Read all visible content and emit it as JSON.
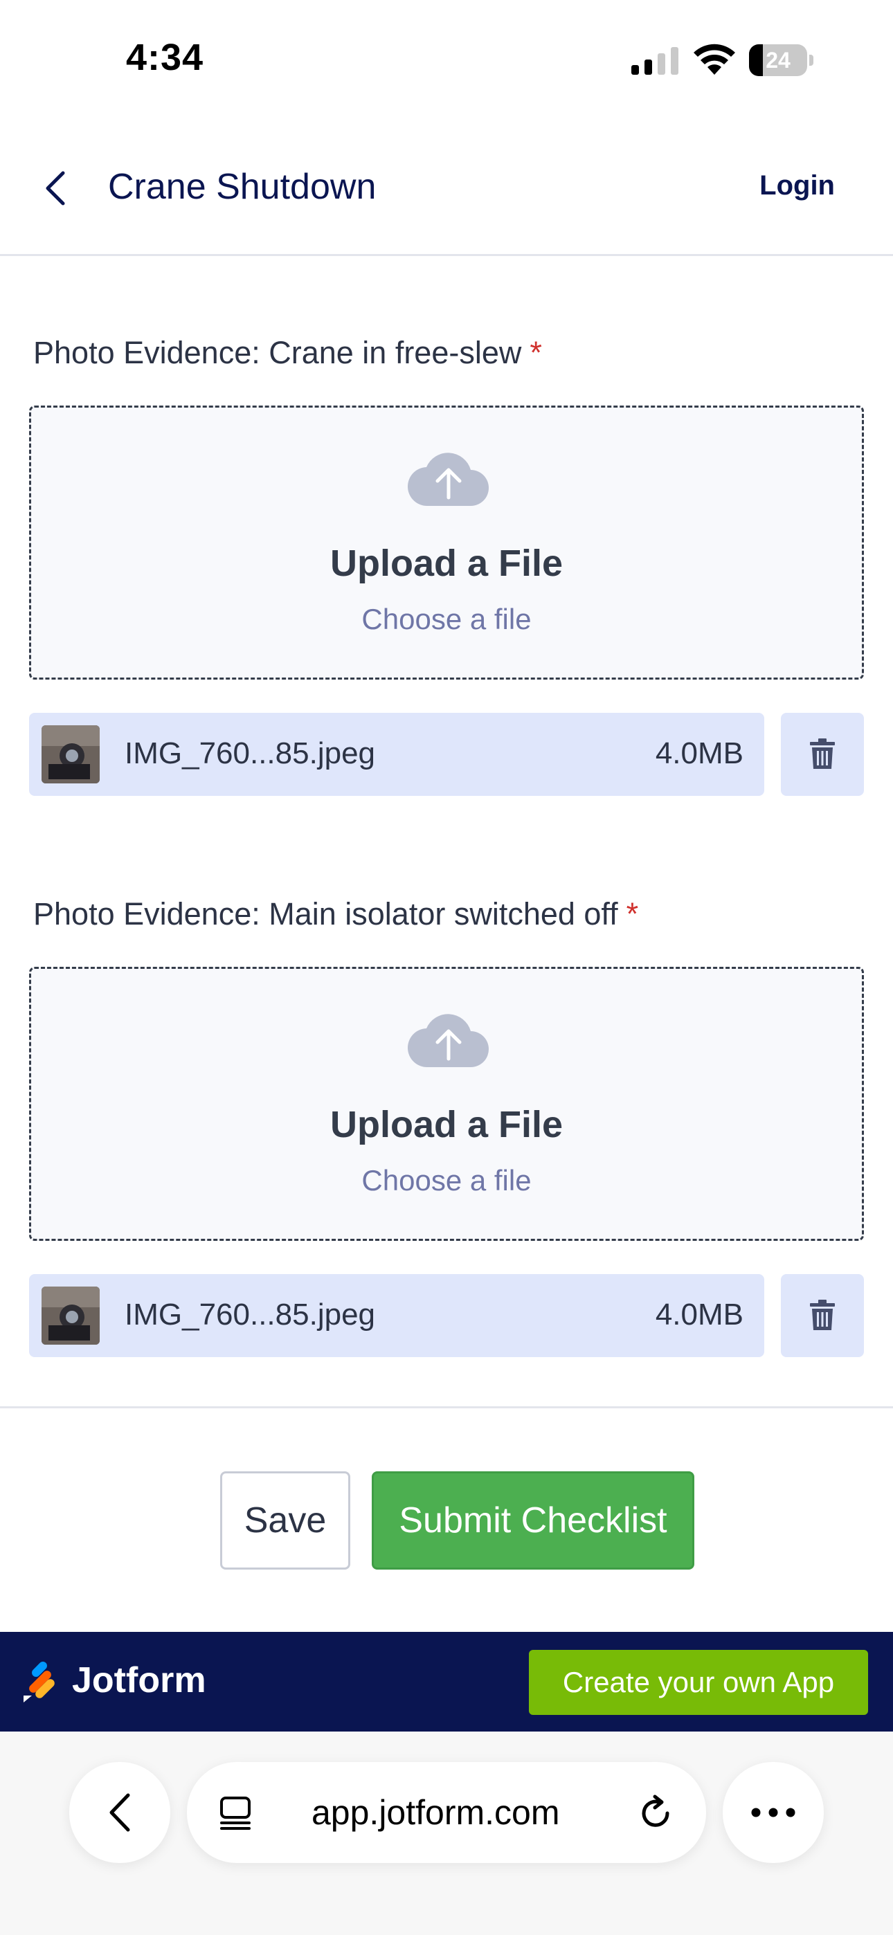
{
  "status_bar": {
    "time": "4:34",
    "battery": "24",
    "battery_level": 0.24
  },
  "header": {
    "title": "Crane Shutdown",
    "login_label": "Login"
  },
  "fields": [
    {
      "label": "Photo Evidence: Crane in free-slew",
      "required_mark": "*",
      "upload_title": "Upload a File",
      "upload_subtitle": "Choose a file",
      "file": {
        "name": "IMG_760...85.jpeg",
        "size": "4.0MB"
      }
    },
    {
      "label": "Photo Evidence: Main isolator switched off",
      "required_mark": "*",
      "upload_title": "Upload a File",
      "upload_subtitle": "Choose a file",
      "file": {
        "name": "IMG_760...85.jpeg",
        "size": "4.0MB"
      }
    }
  ],
  "actions": {
    "save_label": "Save",
    "submit_label": "Submit Checklist"
  },
  "banner": {
    "brand": "Jotform",
    "cta_label": "Create your own App"
  },
  "browser": {
    "url": "app.jotform.com"
  },
  "colors": {
    "submit": "#4caf50",
    "banner": "#0a1551",
    "cta": "#78bb07",
    "file_row": "#dfe6fb",
    "required": "#d0312d"
  }
}
